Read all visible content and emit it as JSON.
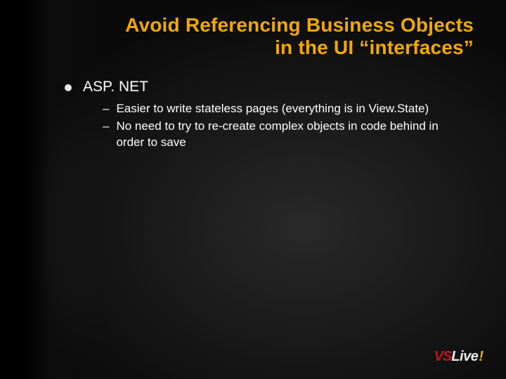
{
  "title": "Avoid Referencing Business Objects\nin the UI “interfaces”",
  "bullets": [
    {
      "text": "ASP. NET",
      "sub": [
        "Easier to write stateless pages (everything is in View.State)",
        "No need to try to re-create complex objects in code behind in order to save"
      ]
    }
  ],
  "logo": {
    "vs": "VS",
    "live": "Live",
    "bang": "!"
  },
  "colors": {
    "accent": "#f2a900",
    "brand_red": "#c1151c"
  }
}
